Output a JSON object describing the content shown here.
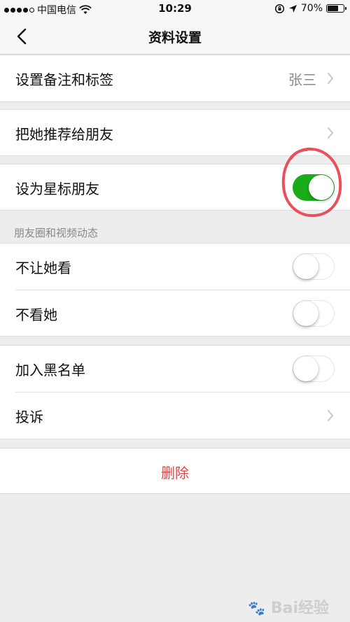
{
  "status_bar": {
    "carrier": "中国电信",
    "time": "10:29",
    "battery": "70%",
    "battery_level": 0.7
  },
  "nav": {
    "title": "资料设置",
    "back_icon": "chevron-left-icon"
  },
  "remark": {
    "label": "设置备注和标签",
    "value": "张三"
  },
  "recommend": {
    "label": "把她推荐给朋友"
  },
  "star": {
    "label": "设为星标朋友",
    "on": true
  },
  "moments": {
    "header": "朋友圈和视频动态",
    "items": [
      {
        "label": "不让她看",
        "on": false
      },
      {
        "label": "不看她",
        "on": false
      }
    ]
  },
  "privacy": {
    "items": [
      {
        "label": "加入黑名单",
        "on": false
      },
      {
        "label": "投诉"
      }
    ]
  },
  "delete": {
    "label": "删除"
  },
  "watermark": {
    "text": "Bai经验"
  },
  "colors": {
    "switch_on": "#1aad19",
    "delete_red": "#e64340",
    "annotation_red": "#e8505b"
  }
}
